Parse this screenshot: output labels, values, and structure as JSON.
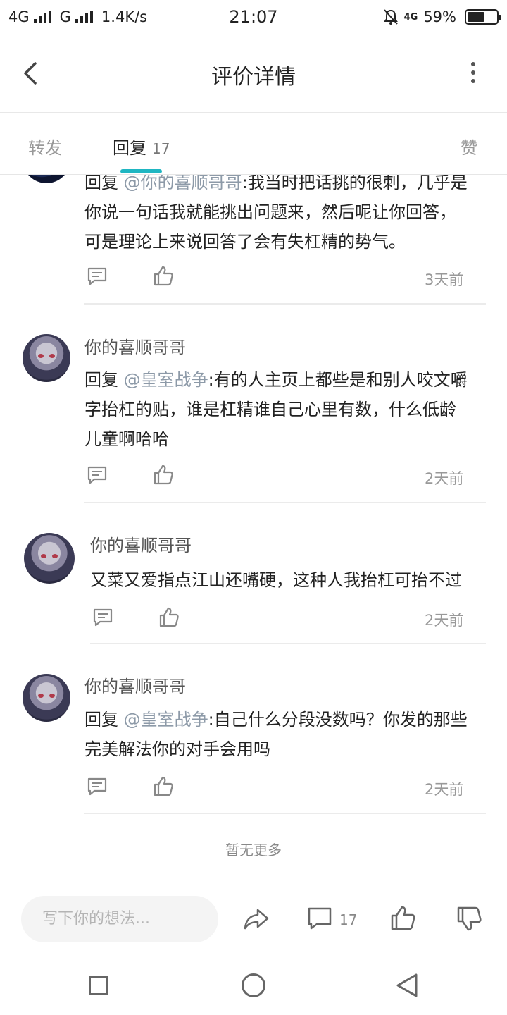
{
  "status_bar": {
    "network1": "4G",
    "network2": "G",
    "speed": "1.4K/s",
    "time": "21:07",
    "battery_label": "59%",
    "battery_level": 0.59,
    "lte_label": "4G"
  },
  "header": {
    "title": "评价详情"
  },
  "tabs": [
    {
      "label": "转发"
    },
    {
      "label": "回复",
      "count": "17"
    },
    {
      "label": "赞"
    }
  ],
  "comments": [
    {
      "reply_prefix": "回复",
      "mention": "@你的喜顺哥哥",
      "text": ":我当时把话挑的很刺，几乎是",
      "text_lines": [
        "你说一句话我就能挑出问题来，然后呢让你回答，",
        "可是理论上来说回答了会有失杠精的势气。"
      ],
      "time": "3天前"
    },
    {
      "name": "你的喜顺哥哥",
      "reply_prefix": "回复",
      "mention": "@皇室战争",
      "text": ":有的人主页上都些是和别人咬文嚼",
      "text_lines": [
        "字抬杠的贴，谁是杠精谁自己心里有数，什么低龄",
        "儿童啊哈哈"
      ],
      "time": "2天前"
    },
    {
      "name": "你的喜顺哥哥",
      "text": "又菜又爱指点江山还嘴硬，这种人我抬杠可抬不过",
      "time": "2天前"
    },
    {
      "name": "你的喜顺哥哥",
      "reply_prefix": "回复",
      "mention": "@皇室战争",
      "text": ":自己什么分段没数吗？你发的那些",
      "text_lines": [
        "完美解法你的对手会用吗"
      ],
      "time": "2天前"
    }
  ],
  "no_more": "暂无更多",
  "bottom_bar": {
    "input_placeholder": "写下你的想法...",
    "comment_count": "17"
  },
  "icons": [
    "back-arrow-icon",
    "more-vertical-icon",
    "reply-comment-icon",
    "like-thumb-icon",
    "share-icon",
    "comment-icon",
    "dislike-thumb-icon"
  ]
}
